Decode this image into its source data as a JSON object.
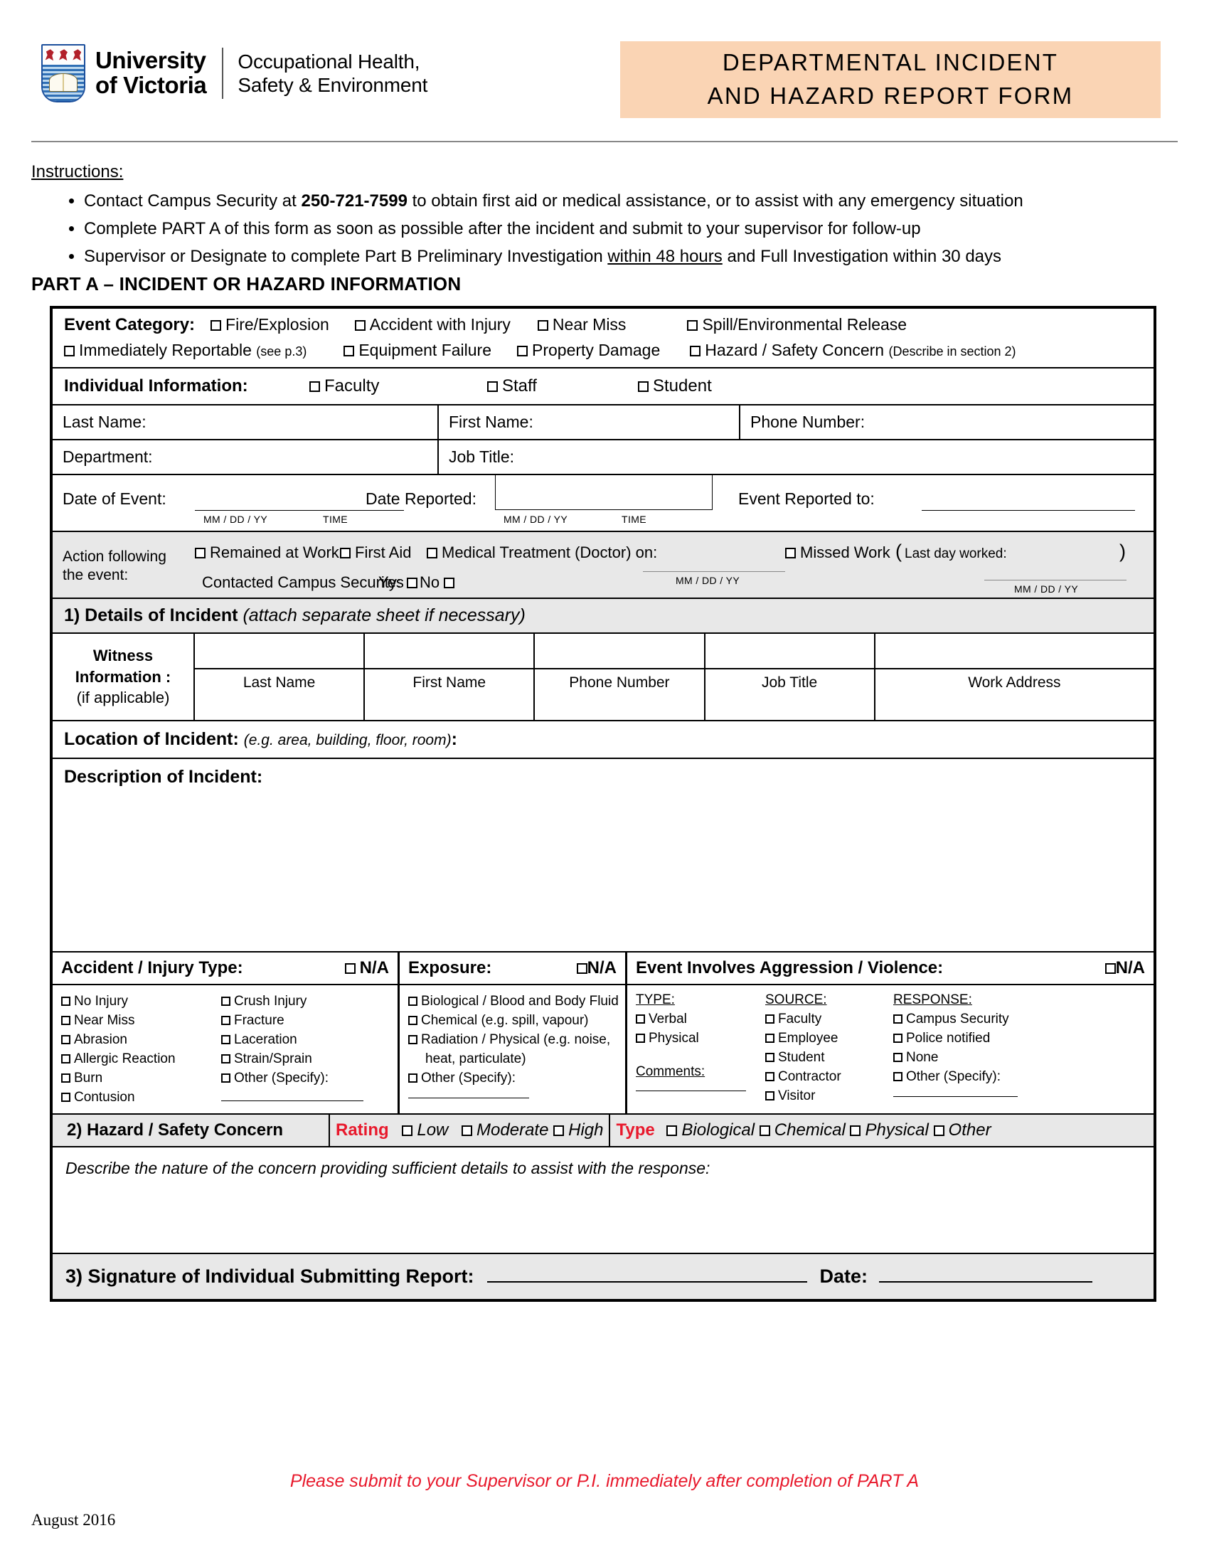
{
  "header": {
    "university_line1": "University",
    "university_line2": "of Victoria",
    "department_line1": "Occupational Health,",
    "department_line2": "Safety & Environment",
    "title_line1": "DEPARTMENTAL INCIDENT",
    "title_line2": "AND HAZARD REPORT FORM",
    "banner_color": "#fad4b4"
  },
  "instructions": {
    "title": "Instructions:",
    "items": [
      {
        "pre": "Contact Campus Security at ",
        "bold": "250-721-7599",
        "post": " to obtain first aid or medical assistance, or to assist with any emergency situation"
      },
      {
        "pre": "Complete PART A of this form as soon as possible after the incident and submit to your supervisor for follow-up",
        "bold": "",
        "post": ""
      },
      {
        "pre": "Supervisor or Designate to complete Part B Preliminary Investigation ",
        "underline": "within 48 hours",
        "post": " and Full Investigation within 30 days"
      }
    ]
  },
  "part_a_heading": "PART A – INCIDENT OR HAZARD INFORMATION",
  "event_category": {
    "label": "Event Category:",
    "row1": [
      "Fire/Explosion",
      "Accident with Injury",
      "Near Miss",
      "Spill/Environmental Release"
    ],
    "row2_item1": "Immediately Reportable",
    "row2_item1_note": "(see p.3)",
    "row2": [
      "Equipment Failure",
      "Property Damage"
    ],
    "row2_item4": "Hazard / Safety Concern",
    "row2_item4_note": "(Describe in section 2)"
  },
  "individual_information": {
    "label": "Individual Information:",
    "options": [
      "Faculty",
      "Staff",
      "Student"
    ],
    "last_name": "Last Name:",
    "first_name": "First Name:",
    "phone_number": "Phone Number:",
    "department": "Department:",
    "job_title": "Job Title:"
  },
  "dates": {
    "date_of_event": "Date of Event:",
    "date_reported": "Date Reported:",
    "event_reported_to": "Event Reported to:",
    "tick_mmddyy": "MM / DD / YY",
    "tick_time": "TIME"
  },
  "action_following": {
    "label_line1": "Action following",
    "label_line2": "the event:",
    "remained_at_work": "Remained at Work",
    "first_aid": "First Aid",
    "medical_treatment": "Medical Treatment (Doctor) on:",
    "missed_work": "Missed Work",
    "last_day_worked": "Last day worked:",
    "contacted_security": "Contacted Campus Security:",
    "yes": "Yes",
    "no": "No",
    "tick_mmddyy": "MM / DD / YY"
  },
  "section1": {
    "heading_bold": "1) Details of Incident",
    "heading_italic": "(attach separate sheet if necessary)",
    "witness_label_line1": "Witness Information :",
    "witness_label_line2": "(if applicable)",
    "witness_columns": [
      "Last Name",
      "First Name",
      "Phone Number",
      "Job Title",
      "Work Address"
    ],
    "location_label": "Location of Incident:",
    "location_hint": "(e.g. area, building, floor, room)",
    "location_colon": ":",
    "description_label": "Description of Incident:"
  },
  "injury_section": {
    "accident_title": "Accident / Injury Type:",
    "accident_na": "N/A",
    "exposure_title": "Exposure:",
    "exposure_na": "N/A",
    "aggression_title": "Event Involves Aggression / Violence:",
    "aggression_na": "N/A",
    "accident_col1": [
      "No Injury",
      "Near Miss",
      "Abrasion",
      "Allergic Reaction",
      "Burn",
      "Contusion"
    ],
    "accident_col2": [
      "Crush Injury",
      "Fracture",
      "Laceration",
      "Strain/Sprain",
      "Other (Specify):"
    ],
    "exposure_items": [
      "Biological / Blood and Body Fluid",
      "Chemical (e.g. spill, vapour)",
      "Radiation / Physical (e.g. noise,",
      "heat, particulate)",
      "Other (Specify):"
    ],
    "type_heading": "TYPE:",
    "type_items": [
      "Verbal",
      "Physical"
    ],
    "comments_label": "Comments:",
    "source_heading": "SOURCE:",
    "source_items": [
      "Faculty",
      "Employee",
      "Student",
      "Contractor",
      "Visitor"
    ],
    "response_heading": "RESPONSE:",
    "response_items": [
      "Campus Security",
      "Police notified",
      "None",
      "Other (Specify):"
    ]
  },
  "section2": {
    "heading": "2) Hazard / Safety Concern",
    "rating_label": "Rating",
    "rating_options": [
      "Low",
      "Moderate",
      "High"
    ],
    "type_label": "Type",
    "type_options": [
      "Biological",
      "Chemical",
      "Physical",
      "Other"
    ],
    "describe_prompt": "Describe the nature of the concern providing sufficient details to assist with the response:",
    "accent_color": "#e8192c"
  },
  "section3": {
    "signature_label": "3) Signature of Individual Submitting Report:",
    "date_label": "Date:"
  },
  "footer": {
    "submit_note": "Please submit to your Supervisor or P.I. immediately after completion of PART A",
    "revision_date": "August 2016"
  }
}
